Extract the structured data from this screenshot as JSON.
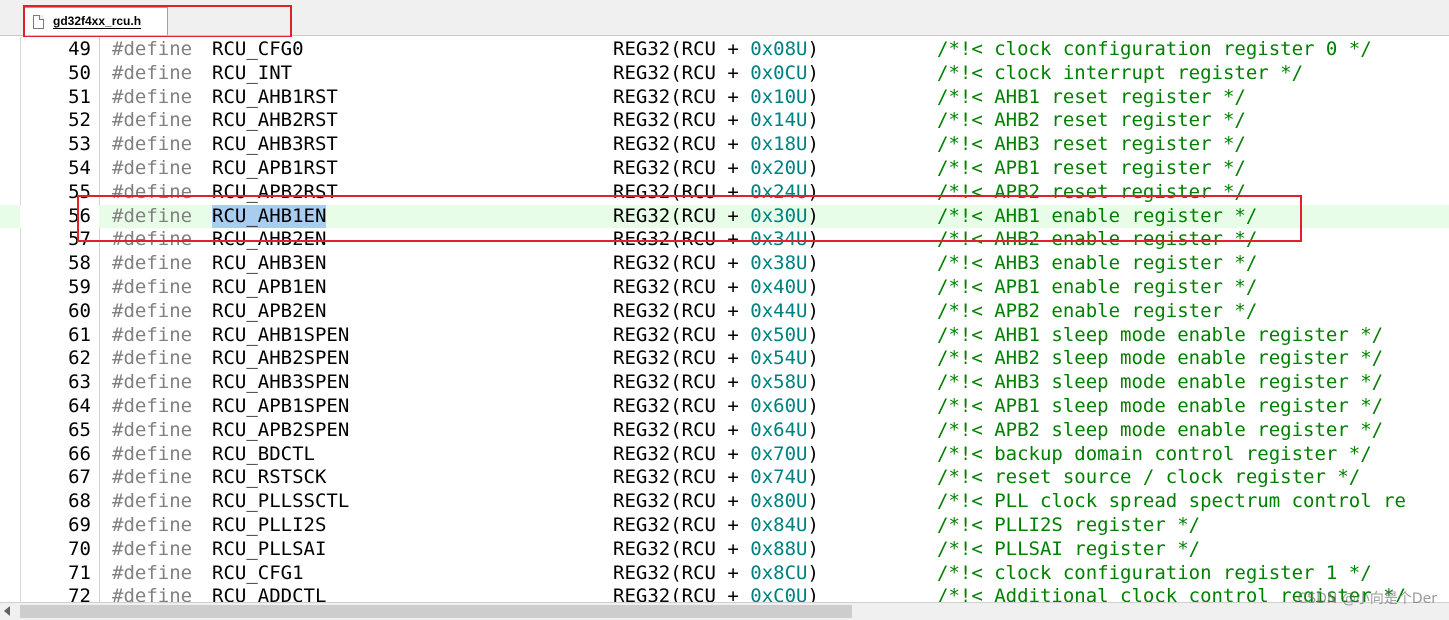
{
  "tab": {
    "filename": "gd32f4xx_rcu.h"
  },
  "colors": {
    "keyword": "#808080",
    "hex": "#008080",
    "comment": "#008000",
    "current_line_bg": "#e8fde8",
    "selection_bg": "#a8cdf1",
    "annotation_box": "#e0202a"
  },
  "editor": {
    "current_line": 56,
    "selected_text": "RCU_AHB1EN",
    "lines": [
      {
        "num": "49",
        "kw": "#define",
        "name": "RCU_CFG0",
        "pre": "REG32(RCU + ",
        "hex": "0x08U",
        "post": ")",
        "comment": "/*!< clock configuration register 0 */"
      },
      {
        "num": "50",
        "kw": "#define",
        "name": "RCU_INT",
        "pre": "REG32(RCU + ",
        "hex": "0x0CU",
        "post": ")",
        "comment": "/*!< clock interrupt register */"
      },
      {
        "num": "51",
        "kw": "#define",
        "name": "RCU_AHB1RST",
        "pre": "REG32(RCU + ",
        "hex": "0x10U",
        "post": ")",
        "comment": "/*!< AHB1 reset register */"
      },
      {
        "num": "52",
        "kw": "#define",
        "name": "RCU_AHB2RST",
        "pre": "REG32(RCU + ",
        "hex": "0x14U",
        "post": ")",
        "comment": "/*!< AHB2 reset register */"
      },
      {
        "num": "53",
        "kw": "#define",
        "name": "RCU_AHB3RST",
        "pre": "REG32(RCU + ",
        "hex": "0x18U",
        "post": ")",
        "comment": "/*!< AHB3 reset register */"
      },
      {
        "num": "54",
        "kw": "#define",
        "name": "RCU_APB1RST",
        "pre": "REG32(RCU + ",
        "hex": "0x20U",
        "post": ")",
        "comment": "/*!< APB1 reset register */"
      },
      {
        "num": "55",
        "kw": "#define",
        "name": "RCU_APB2RST",
        "pre": "REG32(RCU + ",
        "hex": "0x24U",
        "post": ")",
        "comment": "/*!< APB2 reset register */"
      },
      {
        "num": "56",
        "kw": "#define",
        "name": "RCU_AHB1EN",
        "pre": "REG32(RCU + ",
        "hex": "0x30U",
        "post": ")",
        "comment": "/*!< AHB1 enable register */"
      },
      {
        "num": "57",
        "kw": "#define",
        "name": "RCU_AHB2EN",
        "pre": "REG32(RCU + ",
        "hex": "0x34U",
        "post": ")",
        "comment": "/*!< AHB2 enable register */"
      },
      {
        "num": "58",
        "kw": "#define",
        "name": "RCU_AHB3EN",
        "pre": "REG32(RCU + ",
        "hex": "0x38U",
        "post": ")",
        "comment": "/*!< AHB3 enable register */"
      },
      {
        "num": "59",
        "kw": "#define",
        "name": "RCU_APB1EN",
        "pre": "REG32(RCU + ",
        "hex": "0x40U",
        "post": ")",
        "comment": "/*!< APB1 enable register */"
      },
      {
        "num": "60",
        "kw": "#define",
        "name": "RCU_APB2EN",
        "pre": "REG32(RCU + ",
        "hex": "0x44U",
        "post": ")",
        "comment": "/*!< APB2 enable register */"
      },
      {
        "num": "61",
        "kw": "#define",
        "name": "RCU_AHB1SPEN",
        "pre": "REG32(RCU + ",
        "hex": "0x50U",
        "post": ")",
        "comment": "/*!< AHB1 sleep mode enable register */"
      },
      {
        "num": "62",
        "kw": "#define",
        "name": "RCU_AHB2SPEN",
        "pre": "REG32(RCU + ",
        "hex": "0x54U",
        "post": ")",
        "comment": "/*!< AHB2 sleep mode enable register */"
      },
      {
        "num": "63",
        "kw": "#define",
        "name": "RCU_AHB3SPEN",
        "pre": "REG32(RCU + ",
        "hex": "0x58U",
        "post": ")",
        "comment": "/*!< AHB3 sleep mode enable register */"
      },
      {
        "num": "64",
        "kw": "#define",
        "name": "RCU_APB1SPEN",
        "pre": "REG32(RCU + ",
        "hex": "0x60U",
        "post": ")",
        "comment": "/*!< APB1 sleep mode enable register */"
      },
      {
        "num": "65",
        "kw": "#define",
        "name": "RCU_APB2SPEN",
        "pre": "REG32(RCU + ",
        "hex": "0x64U",
        "post": ")",
        "comment": "/*!< APB2 sleep mode enable register */"
      },
      {
        "num": "66",
        "kw": "#define",
        "name": "RCU_BDCTL",
        "pre": "REG32(RCU + ",
        "hex": "0x70U",
        "post": ")",
        "comment": "/*!< backup domain control register */"
      },
      {
        "num": "67",
        "kw": "#define",
        "name": "RCU_RSTSCK",
        "pre": "REG32(RCU + ",
        "hex": "0x74U",
        "post": ")",
        "comment": "/*!< reset source / clock register */"
      },
      {
        "num": "68",
        "kw": "#define",
        "name": "RCU_PLLSSCTL",
        "pre": "REG32(RCU + ",
        "hex": "0x80U",
        "post": ")",
        "comment": "/*!< PLL clock spread spectrum control re"
      },
      {
        "num": "69",
        "kw": "#define",
        "name": "RCU_PLLI2S",
        "pre": "REG32(RCU + ",
        "hex": "0x84U",
        "post": ")",
        "comment": "/*!< PLLI2S register */"
      },
      {
        "num": "70",
        "kw": "#define",
        "name": "RCU_PLLSAI",
        "pre": "REG32(RCU + ",
        "hex": "0x88U",
        "post": ")",
        "comment": "/*!< PLLSAI register */"
      },
      {
        "num": "71",
        "kw": "#define",
        "name": "RCU_CFG1",
        "pre": "REG32(RCU + ",
        "hex": "0x8CU",
        "post": ")",
        "comment": "/*!< clock configuration register 1 */"
      },
      {
        "num": "72",
        "kw": "#define",
        "name": "RCU_ADDCTL",
        "pre": "REG32(RCU + ",
        "hex": "0xC0U",
        "post": ")",
        "comment": "/*!< Additional clock control register */"
      }
    ]
  },
  "watermark": "CSDN @小向是个Der"
}
